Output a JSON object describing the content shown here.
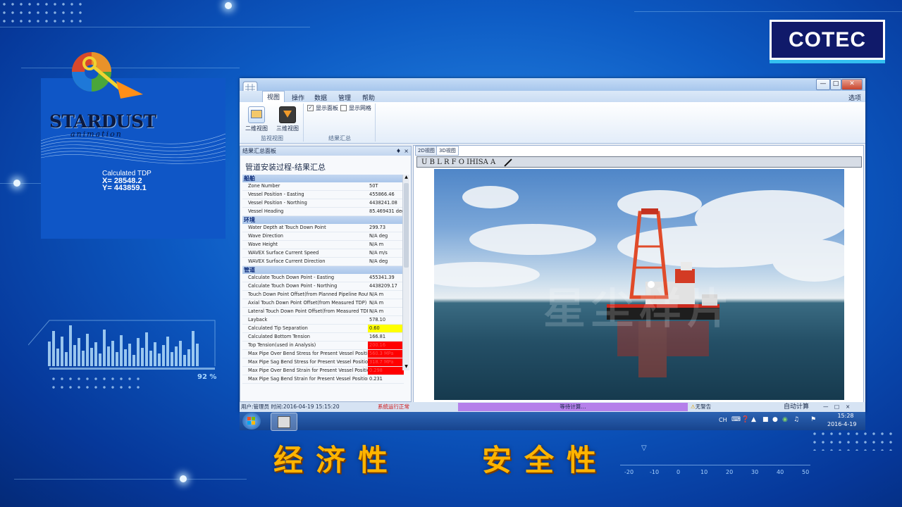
{
  "brand": {
    "cotec": "COTEC",
    "stardust": "STARDUST",
    "stardust_sub": "animation"
  },
  "tdp": {
    "label": "Calculated TDP",
    "x": "X= 28548.2",
    "y": "Y= 443859.1"
  },
  "hud": {
    "percent": "92 %"
  },
  "window": {
    "ribbon_tabs": [
      "视图",
      "操作",
      "数据",
      "管理",
      "帮助"
    ],
    "ribbon_right": "选项",
    "ribbon": {
      "btn_2d": "二维视图",
      "btn_3d": "三维视图",
      "group_view": "监视视图",
      "chk_panel": "显示面板",
      "chk_grid": "显示网格",
      "group_result": "结果汇总"
    },
    "panel_header": "结果汇总面板",
    "panel_title": "管道安装过程-结果汇总",
    "sections": {
      "vessel": "船舶",
      "env": "环境",
      "pipe": "管道"
    },
    "vessel_rows": [
      {
        "name": "Zone Number",
        "value": "50T"
      },
      {
        "name": "Vessel Position - Easting",
        "value": "455866.46"
      },
      {
        "name": "Vessel Position - Northing",
        "value": "4438241.08"
      },
      {
        "name": "Vessel Heading",
        "value": "85.469431 deg"
      }
    ],
    "env_rows": [
      {
        "name": "Water Depth at Touch Down Point",
        "value": "299.73"
      },
      {
        "name": "Wave Direction",
        "value": "N/A deg"
      },
      {
        "name": "Wave Height",
        "value": "N/A m"
      },
      {
        "name": "WAVEX Surface Current Speed",
        "value": "N/A m/s"
      },
      {
        "name": "WAVEX Surface Current Direction",
        "value": "N/A deg"
      }
    ],
    "pipe_rows": [
      {
        "name": "Calculate Touch Down Point - Easting",
        "value": "455341.39"
      },
      {
        "name": "Calculate Touch Down Point - Northing",
        "value": "4438209.17"
      },
      {
        "name": "Touch Down Point Offset(from Planned Pipeline Route)",
        "value": "N/A m"
      },
      {
        "name": "Axial Touch Down Point Offset(from Measured TDP)",
        "value": "N/A m"
      },
      {
        "name": "Lateral Touch Down Point Offset(from Measured TDP)",
        "value": "N/A m"
      },
      {
        "name": "Layback",
        "value": "578.10"
      },
      {
        "name": "Calculated Tip Separation",
        "value": "0.60",
        "hl": "yellow"
      },
      {
        "name": "Calculated Bottom Tension",
        "value": "166.81"
      },
      {
        "name": "Top Tension(used in Analysis)",
        "value": "200.16",
        "hl": "red"
      },
      {
        "name": "Max Pipe Over Bend Stress for Present Vessel Position",
        "value": "560.3 MPa",
        "hl": "red"
      },
      {
        "name": "Max Pipe Sag Bend Stress for Present Vessel Position",
        "value": "318.7 MPa",
        "hl": "red"
      },
      {
        "name": "Max Pipe Over Bend Strain for Present Vessel Position",
        "value": "0.298",
        "hl": "red"
      },
      {
        "name": "Max Pipe Sag Bend Strain for Present Vessel Position",
        "value": "0.231"
      }
    ],
    "view_tabs": [
      "2D视图",
      "3D视图"
    ],
    "toolbar": "U  B  L  R  F  O  IHISA  A",
    "status": {
      "user": "用户:管理员 时间:2016-04-19 15:15:20",
      "system": "系统运行正常",
      "progress": "等待计算...",
      "warning": "无警告",
      "auto": "自动计算"
    }
  },
  "taskbar": {
    "lang": "CH",
    "time": "15:28",
    "date": "2016-4-19"
  },
  "slogans": {
    "left": "经济性",
    "right": "安全性"
  },
  "scale_ticks": [
    "-20",
    "-10",
    "0",
    "10",
    "20",
    "30",
    "40",
    "50"
  ],
  "watermark": "星尘样片",
  "colors": {
    "accent": "#ffb400",
    "cotec_navy": "#101a6a",
    "warning_red": "#ff0000",
    "highlight_yellow": "#ffff00",
    "progress_purple": "#b580ea"
  }
}
